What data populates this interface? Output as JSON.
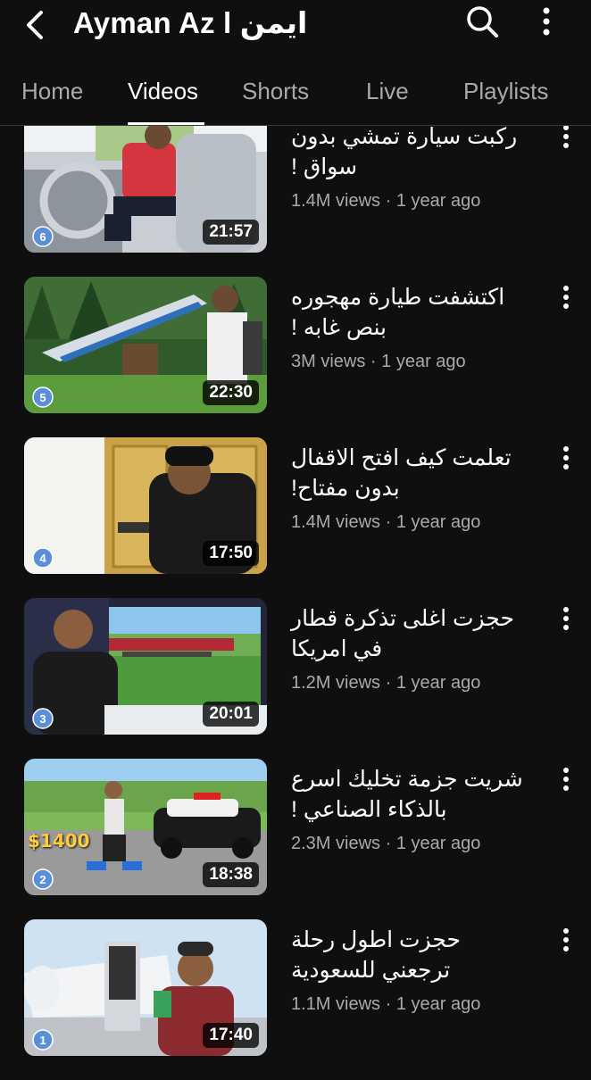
{
  "header": {
    "title": "Ayman Az l ايمن"
  },
  "tabs": [
    {
      "label": "Home"
    },
    {
      "label": "Videos"
    },
    {
      "label": "Shorts"
    },
    {
      "label": "Live"
    },
    {
      "label": "Playlists"
    }
  ],
  "active_tab": "Videos",
  "videos": [
    {
      "title": "ركبت سيارة تمشي بدون سواق !",
      "views": "1.4M views",
      "age": "1 year ago",
      "duration": "21:57",
      "rank": "6"
    },
    {
      "title": "اكتشفت طيارة مهجوره بنص غابه !",
      "views": "3M views",
      "age": "1 year ago",
      "duration": "22:30",
      "rank": "5"
    },
    {
      "title": "تعلمت كيف افتح الاقفال بدون مفتاح!",
      "views": "1.4M views",
      "age": "1 year ago",
      "duration": "17:50",
      "rank": "4"
    },
    {
      "title": "حجزت اغلى تذكرة قطار في امريكا",
      "views": "1.2M views",
      "age": "1 year ago",
      "duration": "20:01",
      "rank": "3"
    },
    {
      "title": "شريت جزمة تخليك اسرع بالذكاء الصناعي !",
      "views": "2.3M views",
      "age": "1 year ago",
      "duration": "18:38",
      "rank": "2",
      "thumb_text": "$1400"
    },
    {
      "title": "حجزت اطول رحلة ترجعني للسعودية",
      "views": "1.1M views",
      "age": "1 year ago",
      "duration": "17:40",
      "rank": "1"
    }
  ],
  "meta_separator": " · ",
  "colors": {
    "background": "#0f0f0f",
    "text_primary": "#ffffff",
    "text_secondary": "#aaaaaa",
    "tab_indicator": "#ffffff"
  },
  "icons": {
    "back": "back-arrow-icon",
    "search": "search-icon",
    "more": "more-vert-icon"
  }
}
